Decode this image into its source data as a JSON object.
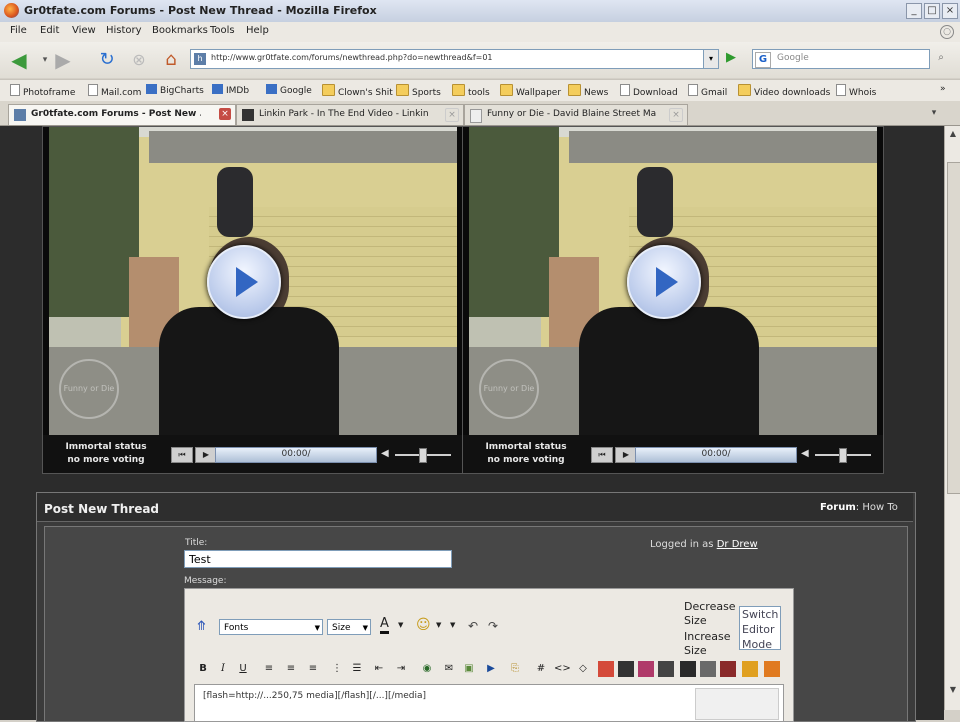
{
  "window": {
    "title": "Gr0tfate.com Forums - Post New Thread - Mozilla Firefox",
    "controls": [
      "_",
      "□",
      "×"
    ]
  },
  "menu": [
    "File",
    "Edit",
    "View",
    "History",
    "Bookmarks",
    "Tools",
    "Help"
  ],
  "nav": {
    "url": "http://www.gr0tfate.com/forums/newthread.php?do=newthread&f=01",
    "search_placeholder": "Google",
    "search_engine_letter": "G"
  },
  "bookmarks": [
    {
      "label": "Photoframe",
      "icon": "page"
    },
    {
      "label": "Mail.com",
      "icon": "page"
    },
    {
      "label": "BigCharts",
      "icon": "color"
    },
    {
      "label": "IMDb",
      "icon": "color"
    },
    {
      "label": "Google",
      "icon": "color"
    },
    {
      "label": "Clown's Shit",
      "icon": "folder"
    },
    {
      "label": "Sports",
      "icon": "folder"
    },
    {
      "label": "tools",
      "icon": "folder"
    },
    {
      "label": "Wallpaper",
      "icon": "folder"
    },
    {
      "label": "News",
      "icon": "folder"
    },
    {
      "label": "Download",
      "icon": "page"
    },
    {
      "label": "Gmail",
      "icon": "page"
    },
    {
      "label": "Video downloads",
      "icon": "folder"
    },
    {
      "label": "Whois",
      "icon": "page"
    }
  ],
  "tabs": [
    {
      "label": "Gr0tfate.com Forums - Post New ...",
      "active": true
    },
    {
      "label": "Linkin Park - In The End Video - Linkin ...",
      "active": false
    },
    {
      "label": "Funny or Die - David Blaine Street Ma...",
      "active": false
    }
  ],
  "videos": [
    {
      "status_line1": "Immortal status",
      "status_line2": "no more voting",
      "time": "00:00/",
      "watermark": "Funny or Die"
    },
    {
      "status_line1": "Immortal status",
      "status_line2": "no more voting",
      "time": "00:00/",
      "watermark": "Funny or Die"
    }
  ],
  "post": {
    "header": "Post New Thread",
    "nav_forum": "Forum",
    "nav_howto": "How To",
    "title_label": "Title:",
    "title_value": "Test",
    "logged_in_prefix": "Logged in as",
    "logged_in_user": "Dr Drew",
    "message_label": "Message:",
    "editor": {
      "font_select": "Fonts",
      "size_select": "Size",
      "decrease_size": "Decrease Size",
      "increase_size": "Increase Size",
      "switch_mode": "Switch Editor Mode",
      "message_text": "[flash=http://...250,75 media][/flash][/...][/media]"
    }
  },
  "colors": {
    "page_bg": "#2c2c2c",
    "link_blue": "#3266c2",
    "close_tab_red": "#c54c44"
  }
}
